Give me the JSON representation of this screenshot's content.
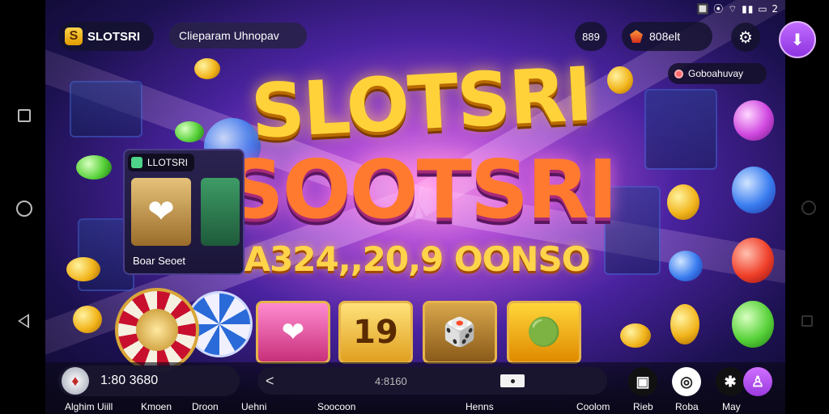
{
  "status_bar": {
    "text": "🔲 ⦿ ⌔ ▮▮ ▭ 2"
  },
  "header": {
    "logo_mark": "S",
    "logo_text": "SLOTSRI",
    "search_text": "Clieparam Uhnopav",
    "count": "889",
    "balance": "808elt",
    "settings_icon": "⚙",
    "gift_icon": "⬇",
    "promo_text": "Goboahuvay"
  },
  "hero": {
    "title_line1": "SLOTSRI",
    "title_line2": "SOOTSRI",
    "jackpot": "A324,,20,9 OONSO"
  },
  "feature_card": {
    "header": "LLOTSRI",
    "label": "Boar Seoet"
  },
  "tiles": [
    "❤",
    "19",
    "🎲",
    "🟢"
  ],
  "bottom_bar": {
    "user_value": "1:80 3680",
    "middle_value": "4:8160",
    "chevron": "<",
    "icon_labels": [
      "▣",
      "◎",
      "✱",
      "♙"
    ]
  },
  "labels": {
    "l1": "Alghim Uiill",
    "l2": "Kmoen",
    "l3": "Droon",
    "l4": "Uehni",
    "l5": "Soocoon",
    "l6": "Henns",
    "l7": "Coolom",
    "l8": "Rieb",
    "l9": "Roba",
    "l10": "May"
  },
  "colors": {
    "accent_gold": "#ffd23a",
    "accent_purple": "#9b3ae0",
    "background": "#1c1150"
  }
}
